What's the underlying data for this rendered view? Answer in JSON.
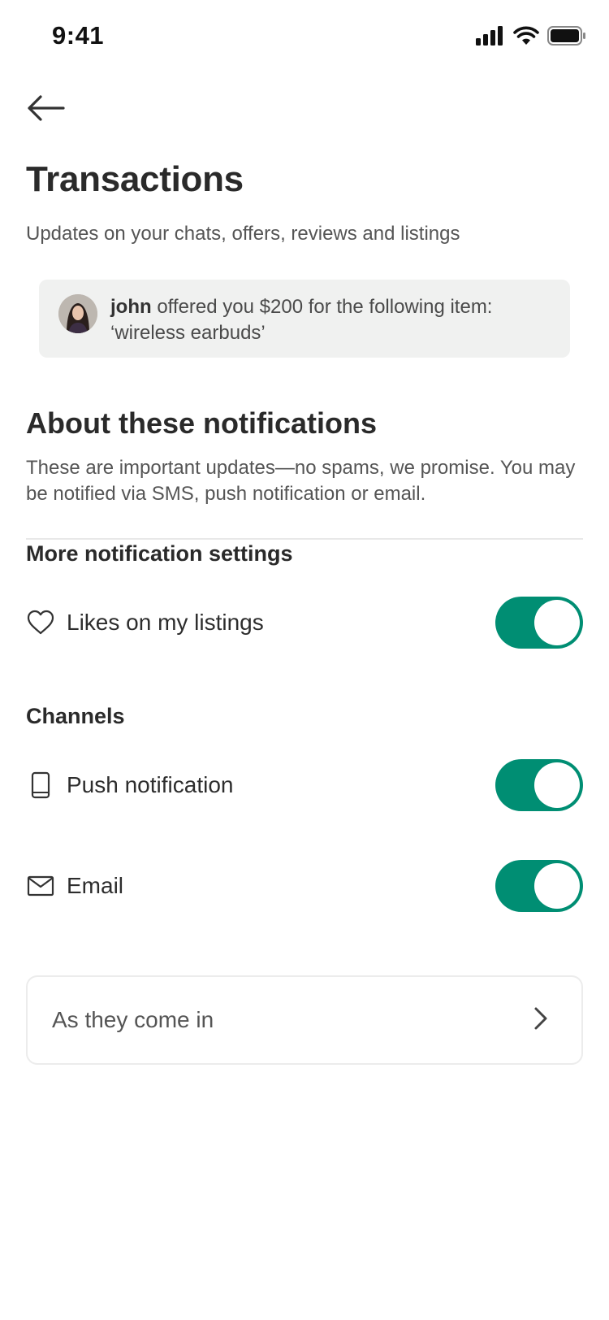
{
  "status_bar": {
    "time": "9:41",
    "icons": [
      "signal-icon",
      "wifi-icon",
      "battery-icon"
    ]
  },
  "header": {
    "back_icon": "arrow-left-icon",
    "title": "Transactions",
    "subtitle": "Updates on your chats, offers, reviews and listings"
  },
  "preview": {
    "user": "john",
    "message": "offered you $200 for the following item: ‘wireless earbuds’"
  },
  "about": {
    "title": "About these notifications",
    "description": "These are important updates—no spams, we promise. You may be notified via SMS, push notification or email."
  },
  "more_settings": {
    "title": "More notification settings",
    "items": [
      {
        "label": "Likes on my listings",
        "icon": "heart-icon",
        "enabled": true
      }
    ]
  },
  "channels": {
    "title": "Channels",
    "items": [
      {
        "label": "Push notification",
        "icon": "phone-icon",
        "enabled": true
      },
      {
        "label": "Email",
        "icon": "mail-icon",
        "enabled": true
      }
    ]
  },
  "frequency": {
    "value": "As they come in",
    "icon": "chevron-right-icon"
  },
  "colors": {
    "accent": "#008e73",
    "card_background": "#f0f1f0",
    "text_primary": "#2a2a2a",
    "text_secondary": "#555555"
  }
}
